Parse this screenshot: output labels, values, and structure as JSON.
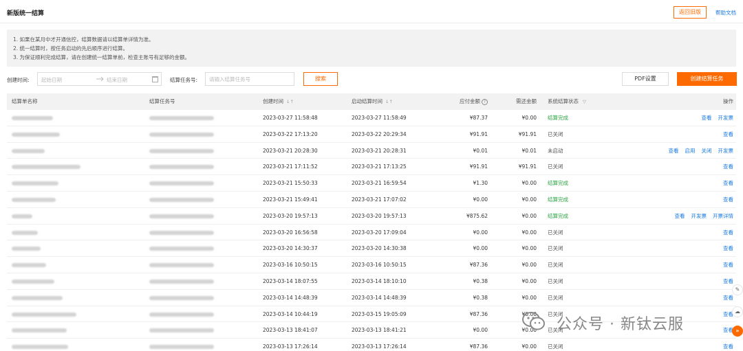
{
  "header": {
    "title": "新版统一结算",
    "back_button": "返回旧版",
    "help_link": "帮助文档"
  },
  "notice": {
    "lines": [
      "1. 如果在某月中才开通信控，结算数据请以结算单详情为准。",
      "2. 统一结算时，按任务启动的先后顺序进行结算。",
      "3. 为保证顺利完成结算，请在创建统一结算单前，检查主账号有足够的金额。"
    ]
  },
  "filters": {
    "create_time_label": "创建时间:",
    "start_placeholder": "起始日期",
    "end_placeholder": "结束日期",
    "task_no_label": "结算任务号:",
    "task_no_placeholder": "请输入结算任务号",
    "search_button": "搜索",
    "pdf_button": "PDF设置",
    "create_button": "创建结算任务"
  },
  "icons": {
    "calendar": "calendar-icon",
    "sort": "sort-icon",
    "question": "question-icon",
    "filter": "filter-icon",
    "pen": "pen-icon",
    "cloud": "cloud-icon",
    "expand": "double-chevron-right-icon",
    "wechat": "wechat-logo-icon"
  },
  "colors": {
    "accent": "#ff6a00",
    "link": "#1b7be0",
    "success": "#2aa641"
  },
  "table": {
    "columns": {
      "name": "结算单名称",
      "task_no": "结算任务号",
      "create_time": "创建时间",
      "start_time": "启动结算时间",
      "amount": "应付金额",
      "repaid": "需还金额",
      "status": "系统结算状态",
      "ops": "操作"
    },
    "sort_glyph": "↓↑",
    "filter_glyph": "▽",
    "question_glyph": "?",
    "rows": [
      {
        "create_time": "2023-03-27 11:58:48",
        "start_time": "2023-03-27 11:58:49",
        "amount": "¥87.37",
        "repaid": "¥0.00",
        "status": "结算完成",
        "status_kind": "ok",
        "ops": [
          "查看",
          "开发票"
        ]
      },
      {
        "create_time": "2023-03-22 17:13:20",
        "start_time": "2023-03-22 20:29:34",
        "amount": "¥91.91",
        "repaid": "¥91.91",
        "status": "已关闭",
        "status_kind": "closed",
        "ops": [
          "查看"
        ]
      },
      {
        "create_time": "2023-03-21 20:28:30",
        "start_time": "2023-03-21 20:28:31",
        "amount": "¥0.01",
        "repaid": "¥0.01",
        "status": "未启动",
        "status_kind": "pending",
        "ops": [
          "查看",
          "启用",
          "关闭",
          "开发票"
        ]
      },
      {
        "create_time": "2023-03-21 17:11:52",
        "start_time": "2023-03-21 17:13:25",
        "amount": "¥91.91",
        "repaid": "¥91.91",
        "status": "已关闭",
        "status_kind": "closed",
        "ops": [
          "查看"
        ]
      },
      {
        "create_time": "2023-03-21 15:50:33",
        "start_time": "2023-03-21 16:59:54",
        "amount": "¥1.30",
        "repaid": "¥0.00",
        "status": "结算完成",
        "status_kind": "ok",
        "ops": [
          "查看"
        ]
      },
      {
        "create_time": "2023-03-21 15:49:41",
        "start_time": "2023-03-21 17:07:02",
        "amount": "¥0.00",
        "repaid": "¥0.00",
        "status": "结算完成",
        "status_kind": "ok",
        "ops": [
          "查看"
        ]
      },
      {
        "create_time": "2023-03-20 19:57:13",
        "start_time": "2023-03-20 19:57:13",
        "amount": "¥875.62",
        "repaid": "¥0.00",
        "status": "结算完成",
        "status_kind": "ok",
        "ops": [
          "查看",
          "开发票",
          "开票详情"
        ]
      },
      {
        "create_time": "2023-03-20 16:56:58",
        "start_time": "2023-03-20 17:09:04",
        "amount": "¥0.00",
        "repaid": "¥0.00",
        "status": "已关闭",
        "status_kind": "closed",
        "ops": [
          "查看"
        ]
      },
      {
        "create_time": "2023-03-20 14:30:37",
        "start_time": "2023-03-20 14:30:38",
        "amount": "¥0.00",
        "repaid": "¥0.00",
        "status": "已关闭",
        "status_kind": "closed",
        "ops": [
          "查看"
        ]
      },
      {
        "create_time": "2023-03-16 10:50:15",
        "start_time": "2023-03-16 10:50:15",
        "amount": "¥87.36",
        "repaid": "¥0.00",
        "status": "已关闭",
        "status_kind": "closed",
        "ops": [
          "查看"
        ]
      },
      {
        "create_time": "2023-03-14 18:07:55",
        "start_time": "2023-03-14 18:10:10",
        "amount": "¥0.38",
        "repaid": "¥0.00",
        "status": "已关闭",
        "status_kind": "closed",
        "ops": [
          "查看"
        ]
      },
      {
        "create_time": "2023-03-14 14:48:39",
        "start_time": "2023-03-14 14:48:39",
        "amount": "¥0.38",
        "repaid": "¥0.00",
        "status": "已关闭",
        "status_kind": "closed",
        "ops": [
          "查看"
        ]
      },
      {
        "create_time": "2023-03-14 10:44:19",
        "start_time": "2023-03-15 19:05:09",
        "amount": "¥87.36",
        "repaid": "¥0.00",
        "status": "已关闭",
        "status_kind": "closed",
        "ops": [
          "查看"
        ]
      },
      {
        "create_time": "2023-03-13 18:41:07",
        "start_time": "2023-03-13 18:41:21",
        "amount": "¥0.00",
        "repaid": "¥0.00",
        "status": "已关闭",
        "status_kind": "closed",
        "ops": [
          "查看"
        ]
      },
      {
        "create_time": "2023-03-13 17:26:14",
        "start_time": "2023-03-13 17:26:14",
        "amount": "¥87.36",
        "repaid": "¥0.00",
        "status": "已关闭",
        "status_kind": "closed",
        "ops": [
          "查看"
        ]
      }
    ]
  },
  "side_tools": {
    "pen_glyph": "✎",
    "cloud_glyph": "☁",
    "expand_glyph": "»"
  },
  "watermark": {
    "text": "公众号 · 新钛云服"
  }
}
